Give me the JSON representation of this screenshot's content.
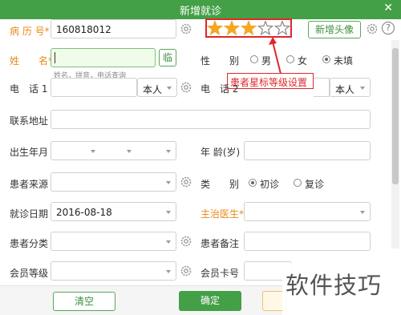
{
  "window": {
    "title": "新增就诊",
    "close_glyph": "✕"
  },
  "fields": {
    "record_no": {
      "label": "病 历 号*",
      "value": "160818012"
    },
    "name": {
      "label": "姓　　名*",
      "value": "",
      "hint": "姓名，拼音，电话查询",
      "button": "临"
    },
    "gender": {
      "label": "性　　别",
      "options": [
        "男",
        "女",
        "未填"
      ],
      "selected": "未填"
    },
    "phone1": {
      "label": "电　话 1",
      "value": "",
      "relation": "本人"
    },
    "phone2": {
      "label": "电　话 2",
      "value": "",
      "relation": "本人"
    },
    "address": {
      "label": "联系地址",
      "value": ""
    },
    "birth": {
      "label": "出生年月",
      "value": ""
    },
    "age": {
      "label": "年 龄(岁)",
      "value": ""
    },
    "source": {
      "label": "患者来源",
      "value": ""
    },
    "category": {
      "label": "类　　别",
      "options": [
        "初诊",
        "复诊"
      ],
      "selected": "初诊"
    },
    "visit_date": {
      "label": "就诊日期",
      "value": "2016-08-18"
    },
    "doctor": {
      "label": "主治医生*",
      "value": ""
    },
    "patient_class": {
      "label": "患者分类",
      "value": ""
    },
    "patient_note": {
      "label": "患者备注",
      "value": ""
    },
    "member_level": {
      "label": "会员等级",
      "value": ""
    },
    "member_card": {
      "label": "会员卡号",
      "value": ""
    }
  },
  "rating": {
    "value": 3,
    "max": 5,
    "color": "#f5a623"
  },
  "add_avatar_button": "新增头像",
  "annotation": {
    "text": "患者星标等级设置",
    "color": "#e0262a"
  },
  "footer": {
    "clear_button": "清空",
    "confirm_button": "确定"
  },
  "watermark": "软件技巧",
  "colors": {
    "titlebar": "#43a047",
    "label_required": "#e88a1a",
    "confirm": "#43a047"
  }
}
